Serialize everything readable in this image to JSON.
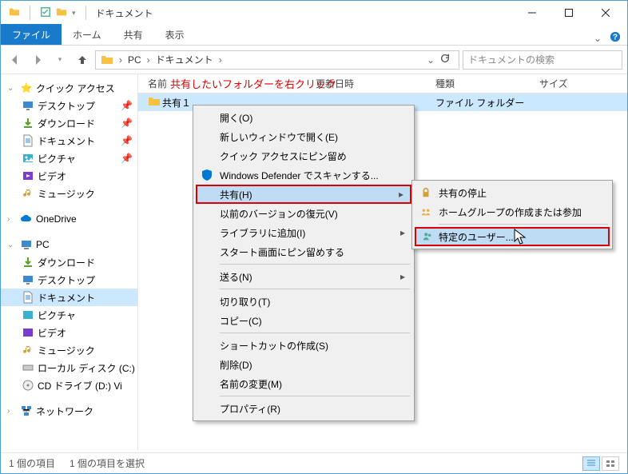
{
  "titlebar": {
    "title": "ドキュメント"
  },
  "ribbon": {
    "file": "ファイル",
    "tabs": [
      "ホーム",
      "共有",
      "表示"
    ]
  },
  "breadcrumb": {
    "parts": [
      "PC",
      "ドキュメント"
    ],
    "search_placeholder": "ドキュメントの検索"
  },
  "annotation": "共有したいフォルダーを右クリック",
  "columns": {
    "name": "名前",
    "date": "更新日時",
    "type": "種類",
    "size": "サイズ"
  },
  "tree": {
    "quick_access": "クイック アクセス",
    "qa_items": [
      "デスクトップ",
      "ダウンロード",
      "ドキュメント",
      "ピクチャ",
      "ビデオ",
      "ミュージック"
    ],
    "onedrive": "OneDrive",
    "pc": "PC",
    "pc_items": [
      "ダウンロード",
      "デスクトップ",
      "ドキュメント",
      "ピクチャ",
      "ビデオ",
      "ミュージック",
      "ローカル ディスク (C:)",
      "CD ドライブ (D:) Vi"
    ],
    "network": "ネットワーク"
  },
  "file_row": {
    "name": "共有１",
    "type": "ファイル フォルダー"
  },
  "context_menu": {
    "open": "開く(O)",
    "open_new": "新しいウィンドウで開く(E)",
    "pin_qa": "クイック アクセスにピン留め",
    "defender": "Windows Defender でスキャンする...",
    "share": "共有(H)",
    "prev_ver": "以前のバージョンの復元(V)",
    "library": "ライブラリに追加(I)",
    "pin_start": "スタート画面にピン留めする",
    "send_to": "送る(N)",
    "cut": "切り取り(T)",
    "copy": "コピー(C)",
    "shortcut": "ショートカットの作成(S)",
    "delete": "削除(D)",
    "rename": "名前の変更(M)",
    "properties": "プロパティ(R)"
  },
  "submenu": {
    "stop": "共有の停止",
    "homegroup": "ホームグループの作成または参加",
    "specific": "特定のユーザー..."
  },
  "status": {
    "count": "1 個の項目",
    "selected": "1 個の項目を選択"
  }
}
